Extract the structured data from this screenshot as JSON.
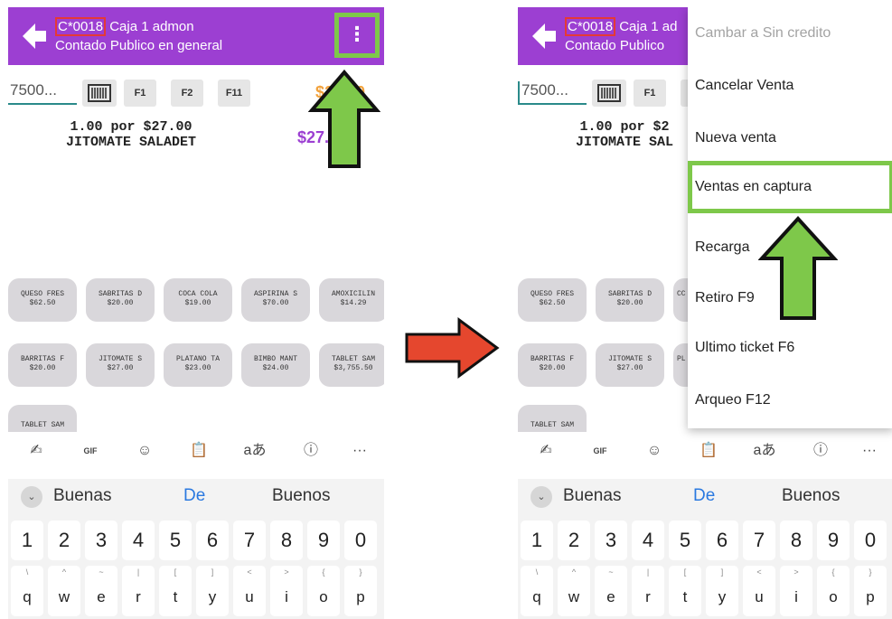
{
  "screens": [
    {
      "header": {
        "code": "C*0018",
        "title_rest": " Caja 1 admon",
        "subtitle": "Contado Publico en general",
        "menu_icon": "⋮"
      },
      "search": {
        "value": "7500..."
      },
      "fkeys": [
        "F1",
        "F2",
        "F11"
      ],
      "total": "$27.00",
      "item": {
        "line1": "1.00 por $27.00",
        "line2": "JITOMATE SALADET",
        "price": "$27.00"
      },
      "products": [
        {
          "name": "QUESO FRES",
          "price": "$62.50"
        },
        {
          "name": "SABRITAS D",
          "price": "$20.00"
        },
        {
          "name": "COCA COLA",
          "price": "$19.00"
        },
        {
          "name": "ASPIRINA S",
          "price": "$70.00"
        },
        {
          "name": "AMOXICILIN",
          "price": "$14.29"
        },
        {
          "name": "BARRITAS F",
          "price": "$20.00"
        },
        {
          "name": "JITOMATE S",
          "price": "$27.00"
        },
        {
          "name": "PLATANO TA",
          "price": "$23.00"
        },
        {
          "name": "BIMBO MANT",
          "price": "$24.00"
        },
        {
          "name": "TABLET SAM",
          "price": "$3,755.50"
        },
        {
          "name": "TABLET SAM",
          "price": ""
        }
      ]
    },
    {
      "header": {
        "code": "C*0018",
        "title_rest": " Caja 1 ad",
        "subtitle": "Contado Publico"
      },
      "search": {
        "value": "7500..."
      },
      "fkeys": [
        "F1"
      ],
      "item": {
        "line1": "1.00 por $2",
        "line2": "JITOMATE SAL"
      },
      "products": [
        {
          "name": "QUESO FRES",
          "price": "$62.50"
        },
        {
          "name": "SABRITAS D",
          "price": "$20.00"
        },
        {
          "name": "CC",
          "price": ""
        },
        {
          "name": "BARRITAS F",
          "price": "$20.00"
        },
        {
          "name": "JITOMATE S",
          "price": "$27.00"
        },
        {
          "name": "PL",
          "price": ""
        },
        {
          "name": "TABLET SAM",
          "price": ""
        }
      ],
      "menu": [
        "Cambar a Sin credito",
        "Cancelar Venta",
        "Nueva venta",
        "Ventas en captura",
        "Recarga",
        "Retiro F9",
        "Ultimo ticket F6",
        "Arqueo F12"
      ]
    }
  ],
  "toolbar": {
    "lang_label": "aあ",
    "more_label": "···",
    "gif_label": "GIF",
    "icons": [
      "handwriting-icon",
      "gif-icon",
      "sticker-icon",
      "clipboard-icon",
      "language-icon",
      "info-icon",
      "more-icon"
    ]
  },
  "suggestions": [
    "Buenas",
    "De",
    "Buenos"
  ],
  "keyboard": {
    "numbers": [
      "1",
      "2",
      "3",
      "4",
      "5",
      "6",
      "7",
      "8",
      "9",
      "0"
    ],
    "letters": [
      "q",
      "w",
      "e",
      "r",
      "t",
      "y",
      "u",
      "i",
      "o",
      "p"
    ],
    "hints": [
      "\\",
      "^",
      "~",
      "|",
      "[",
      "]",
      "<",
      ">",
      "{",
      "}"
    ]
  },
  "colors": {
    "app_bar": "#9c3fd2",
    "highlight_green": "#7ec84a",
    "highlight_red": "#e53935",
    "arrow_red": "#e5472e",
    "total_orange": "#f2a23c"
  }
}
